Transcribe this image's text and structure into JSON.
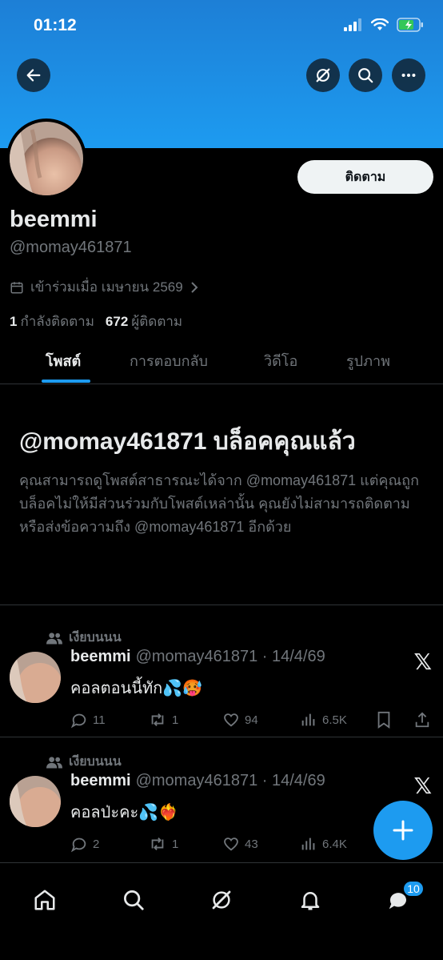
{
  "status_bar": {
    "time": "01:12"
  },
  "colors": {
    "accent": "#1d9bf0",
    "banner": "#1d9bf0",
    "muted": "#71767b",
    "text": "#e7e9ea"
  },
  "header": {
    "icons": [
      "back-arrow-icon",
      "grok-icon",
      "search-icon",
      "more-icon"
    ]
  },
  "profile": {
    "display_name": "beemmi",
    "handle": "@momay461871",
    "follow_label": "ติดตาม",
    "joined": "เข้าร่วมเมื่อ เมษายน 2569",
    "following_count": "1",
    "following_label": "กำลังติดตาม",
    "followers_count": "672",
    "followers_label": "ผู้ติดตาม"
  },
  "tabs": [
    {
      "label": "โพสต์",
      "active": true
    },
    {
      "label": "การตอบกลับ",
      "active": false
    },
    {
      "label": "วิดีโอ",
      "active": false
    },
    {
      "label": "รูปภาพ",
      "active": false
    }
  ],
  "blocked": {
    "title": "@momay461871 บล็อคคุณแล้ว",
    "text": "คุณสามารถดูโพสต์สาธารณะได้จาก @momay461871 แต่คุณถูกบล็อคไม่ให้มีส่วนร่วมกับโพสต์เหล่านั้น คุณยังไม่สามารถติดตามหรือส่งข้อความถึง @momay461871 อีกด้วย"
  },
  "posts": [
    {
      "context": "เงียบนนน",
      "name": "beemmi",
      "handle": "@momay461871",
      "date": "14/4/69",
      "text": "คอลตอนนี้ทัก💦🥵",
      "replies": "11",
      "reposts": "1",
      "likes": "94",
      "views": "6.5K"
    },
    {
      "context": "เงียบนนน",
      "name": "beemmi",
      "handle": "@momay461871",
      "date": "14/4/69",
      "text": "คอลป่ะคะ💦❤️‍🔥",
      "replies": "2",
      "reposts": "1",
      "likes": "43",
      "views": "6.4K"
    }
  ],
  "nav": {
    "icons": [
      "home-icon",
      "search-icon",
      "grok-icon",
      "notifications-icon",
      "messages-icon"
    ],
    "messages_badge": "10"
  }
}
